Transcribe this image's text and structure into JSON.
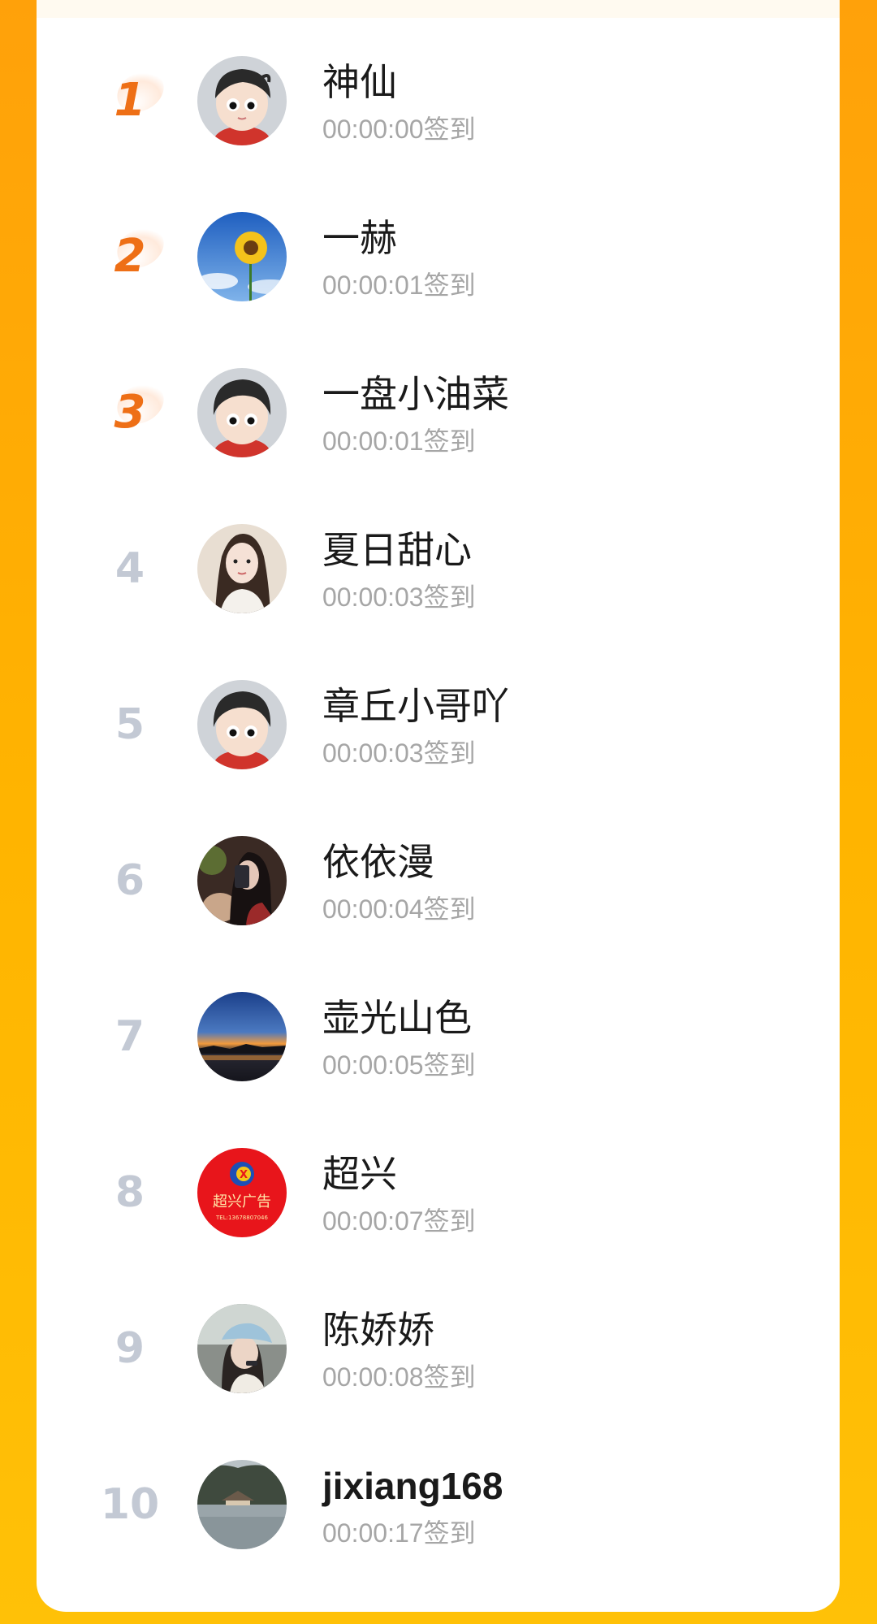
{
  "ranking": {
    "check_in_suffix": "签到",
    "entries": [
      {
        "rank": "1",
        "name": "神仙",
        "time": "00:00:00签到",
        "avatar_icon": "cartoon-boy-avatar-icon"
      },
      {
        "rank": "2",
        "name": "一赫",
        "time": "00:00:01签到",
        "avatar_icon": "sunflower-avatar-icon"
      },
      {
        "rank": "3",
        "name": "一盘小油菜",
        "time": "00:00:01签到",
        "avatar_icon": "cartoon-boy-avatar-icon"
      },
      {
        "rank": "4",
        "name": "夏日甜心",
        "time": "00:00:03签到",
        "avatar_icon": "girl-portrait-avatar-icon"
      },
      {
        "rank": "5",
        "name": "章丘小哥吖",
        "time": "00:00:03签到",
        "avatar_icon": "cartoon-boy-avatar-icon"
      },
      {
        "rank": "6",
        "name": "依依漫",
        "time": "00:00:04签到",
        "avatar_icon": "selfie-avatar-icon"
      },
      {
        "rank": "7",
        "name": "壶光山色",
        "time": "00:00:05签到",
        "avatar_icon": "sunset-lake-avatar-icon"
      },
      {
        "rank": "8",
        "name": "超兴",
        "time": "00:00:07签到",
        "avatar_icon": "chaoxing-ad-logo-avatar-icon",
        "avatar_text": {
          "main": "超兴广告",
          "tel": "TEL:13678807046"
        }
      },
      {
        "rank": "9",
        "name": "陈娇娇",
        "time": "00:00:08签到",
        "avatar_icon": "girl-cap-avatar-icon"
      },
      {
        "rank": "10",
        "name": "jixiang168",
        "time": "00:00:17签到",
        "avatar_icon": "lake-pavilion-avatar-icon"
      }
    ]
  },
  "colors": {
    "background_top": "#ffa10a",
    "background_bottom": "#ffc107",
    "rank_top3": "#ee6f16",
    "rank_other": "#c3c9d4",
    "name": "#1a1a1a",
    "time": "#a6a6a6"
  }
}
